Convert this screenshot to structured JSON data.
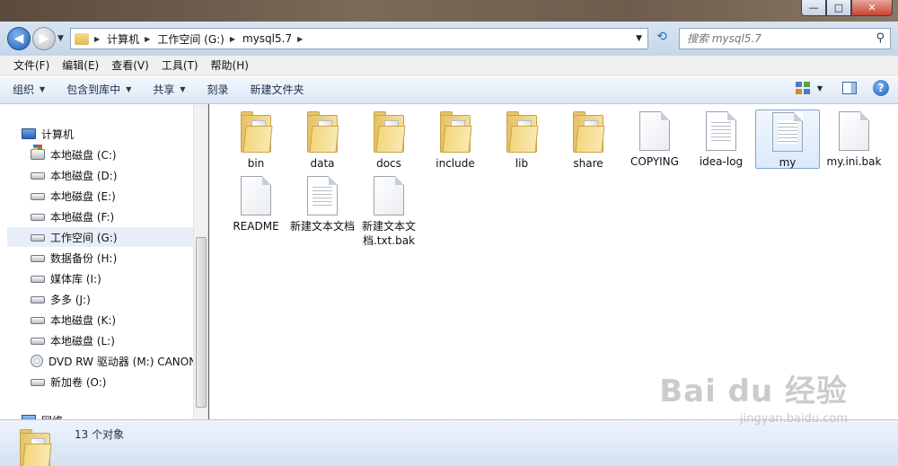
{
  "window": {
    "min_glyph": "—",
    "max_glyph": "□",
    "close_glyph": "✕"
  },
  "address": {
    "crumbs": [
      "计算机",
      "工作空间 (G:)",
      "mysql5.7"
    ],
    "search_placeholder": "搜索 mysql5.7"
  },
  "menu": [
    "文件(F)",
    "编辑(E)",
    "查看(V)",
    "工具(T)",
    "帮助(H)"
  ],
  "commands": {
    "organize": "组织",
    "include_in_library": "包含到库中",
    "share": "共享",
    "burn": "刻录",
    "new_folder": "新建文件夹"
  },
  "nav": {
    "computer": "计算机",
    "drives": [
      {
        "label": "本地磁盘 (C:)",
        "icon": "windows-drive-icon"
      },
      {
        "label": "本地磁盘 (D:)",
        "icon": "drive-icon"
      },
      {
        "label": "本地磁盘 (E:)",
        "icon": "drive-icon"
      },
      {
        "label": "本地磁盘 (F:)",
        "icon": "drive-icon"
      },
      {
        "label": "工作空间 (G:)",
        "icon": "drive-icon",
        "selected": true
      },
      {
        "label": "数据备份 (H:)",
        "icon": "drive-icon"
      },
      {
        "label": "媒体库 (I:)",
        "icon": "drive-icon"
      },
      {
        "label": "多多 (J:)",
        "icon": "drive-icon"
      },
      {
        "label": "本地磁盘 (K:)",
        "icon": "drive-icon"
      },
      {
        "label": "本地磁盘 (L:)",
        "icon": "drive-icon"
      },
      {
        "label": "DVD RW 驱动器 (M:) CANON",
        "icon": "dvd-drive-icon"
      },
      {
        "label": "新加卷 (O:)",
        "icon": "drive-icon"
      }
    ],
    "network": "网络"
  },
  "files": [
    {
      "name": "bin",
      "type": "folder"
    },
    {
      "name": "data",
      "type": "folder"
    },
    {
      "name": "docs",
      "type": "folder"
    },
    {
      "name": "include",
      "type": "folder"
    },
    {
      "name": "lib",
      "type": "folder"
    },
    {
      "name": "share",
      "type": "folder"
    },
    {
      "name": "COPYING",
      "type": "file"
    },
    {
      "name": "idea-log",
      "type": "text-file"
    },
    {
      "name": "my",
      "type": "text-file",
      "selected": true
    },
    {
      "name": "my.ini.bak",
      "type": "file"
    },
    {
      "name": "README",
      "type": "file"
    },
    {
      "name": "新建文本文档",
      "type": "text-file"
    },
    {
      "name": "新建文本文档.txt.bak",
      "type": "file"
    }
  ],
  "status": {
    "count": "13 个对象"
  },
  "watermark": {
    "brand": "Bai du 经验",
    "url": "jingyan.baidu.com"
  }
}
